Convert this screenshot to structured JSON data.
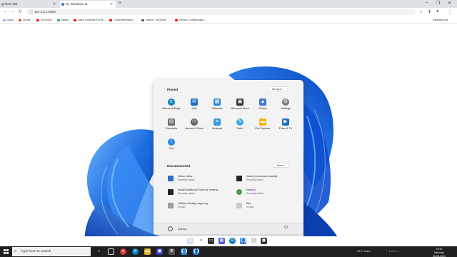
{
  "browser": {
    "tabs": [
      {
        "label": "New Tab"
      },
      {
        "label": "Try Windows 11"
      }
    ],
    "url": "127.0.0.1:5500",
    "bookmarks": [
      {
        "label": "Apps",
        "color": "#8ab4f8"
      },
      {
        "label": "Gmail",
        "color": "#ea4335"
      },
      {
        "label": "YouTube",
        "color": "#ff0000"
      },
      {
        "label": "Maps",
        "color": "#34a853"
      },
      {
        "label": "Java Tutorials For B...",
        "color": "#ff0000"
      },
      {
        "label": "CodeWithHarry",
        "color": "#ff0000"
      },
      {
        "label": "Home - MyTools",
        "color": "#555555"
      },
      {
        "label": "Server Configuratio...",
        "color": "#ff0000"
      }
    ],
    "reading_list": "Reading list"
  },
  "start_menu": {
    "pinned_title": "Pinned",
    "all_apps": "All apps  ›",
    "pinned": [
      {
        "label": "Microsoft Edge",
        "icon": "edge-icon",
        "color": "#0f7fc8"
      },
      {
        "label": "Mail",
        "icon": "mail-icon",
        "color": "#1a73c9"
      },
      {
        "label": "Calendar",
        "icon": "calendar-icon",
        "color": "#2a86d6"
      },
      {
        "label": "Microsoft Store",
        "icon": "store-icon",
        "color": "#333333"
      },
      {
        "label": "Photos",
        "icon": "photos-icon",
        "color": "#3f7ad3"
      },
      {
        "label": "Settings",
        "icon": "gear-icon",
        "color": "#7a7a7a"
      },
      {
        "label": "Calculator",
        "icon": "calculator-icon",
        "color": "#6b6b6b"
      },
      {
        "label": "Alarms & Clock",
        "icon": "clock-icon",
        "color": "#5a5a5a"
      },
      {
        "label": "Notepad",
        "icon": "notepad-icon",
        "color": "#3a9ad9"
      },
      {
        "label": "Paint",
        "icon": "paint-icon",
        "color": "#41a5e1"
      },
      {
        "label": "File Explorer",
        "icon": "folder-icon",
        "color": "#f2b705"
      },
      {
        "label": "Films & TV",
        "icon": "film-icon",
        "color": "#1b6fc2"
      },
      {
        "label": "Tips",
        "icon": "tips-icon",
        "color": "#2b8be0"
      }
    ],
    "recommended_title": "Recommended",
    "more": "More  ›",
    "recommended": [
      {
        "name": "Vision editor",
        "sub": "Recently added",
        "color": "#2f6fc4"
      },
      {
        "name": "Node.js command prompt",
        "sub": "Recently added",
        "color": "#222222"
      },
      {
        "name": "Install Additional Tools for Node.js",
        "sub": "Recently added",
        "color": "#222222"
      },
      {
        "name": "Node.js",
        "sub": "Recently added",
        "color": "#4a9c47"
      },
      {
        "name": "1280px-Nodejs_logo.svg",
        "sub": "3h ago",
        "color": "#9aa0a6"
      },
      {
        "name": "files",
        "sub": "3h ago",
        "color": "#c9c9c9"
      }
    ],
    "user": "manny"
  },
  "taskbar": {
    "search_placeholder": "Type here to search",
    "weather": "26°C  Haze",
    "time": "19:41",
    "day": "Saturday",
    "date": "26-06-2021"
  }
}
